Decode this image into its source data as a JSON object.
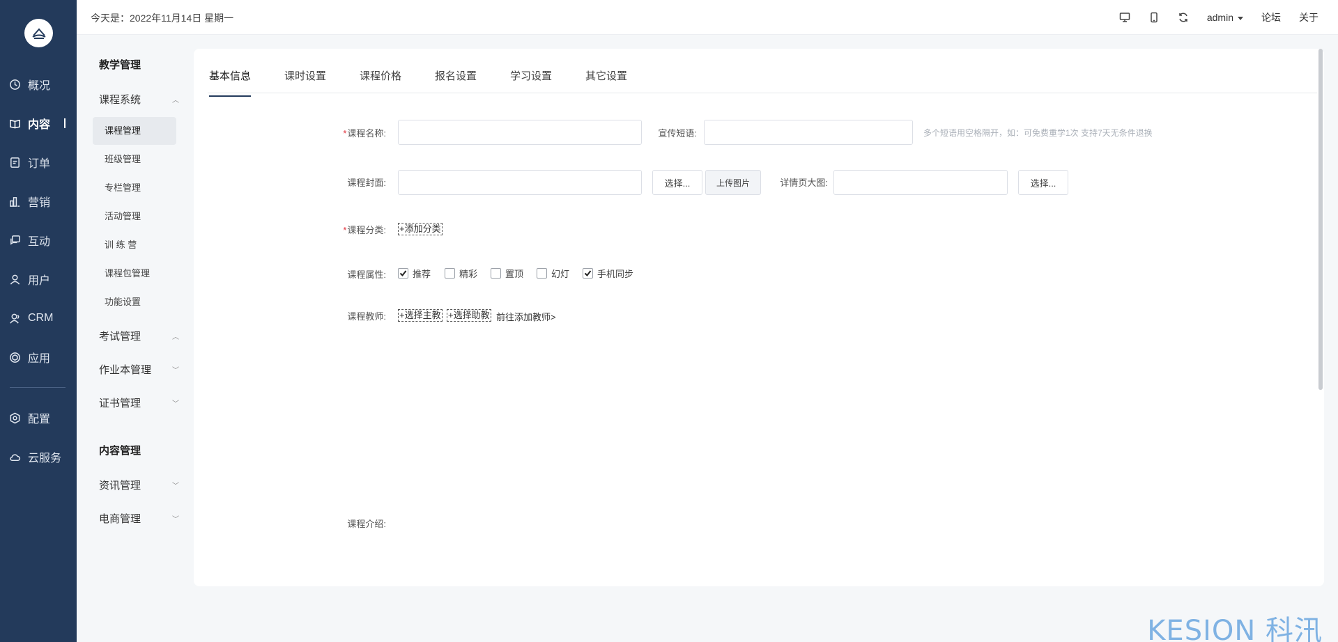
{
  "topbar": {
    "date_text": "今天是：2022年11月14日 星期一",
    "user": "admin",
    "forum": "论坛",
    "about": "关于"
  },
  "nav": {
    "items": [
      {
        "label": "概况",
        "icon": "clock-icon"
      },
      {
        "label": "内容",
        "icon": "book-icon"
      },
      {
        "label": "订单",
        "icon": "document-icon"
      },
      {
        "label": "营销",
        "icon": "bar-chart-icon"
      },
      {
        "label": "互动",
        "icon": "chat-icon"
      },
      {
        "label": "用户",
        "icon": "user-icon"
      },
      {
        "label": "CRM",
        "icon": "contacts-icon"
      },
      {
        "label": "应用",
        "icon": "cube-icon"
      },
      {
        "label": "配置",
        "icon": "gear-icon"
      },
      {
        "label": "云服务",
        "icon": "cloud-icon"
      }
    ]
  },
  "subnav": {
    "heading1": "教学管理",
    "group_course": "课程系统",
    "items": [
      "课程管理",
      "班级管理",
      "专栏管理",
      "活动管理",
      "训 练 营",
      "课程包管理",
      "功能设置"
    ],
    "group_exam": "考试管理",
    "group_homework": "作业本管理",
    "group_cert": "证书管理",
    "heading2": "内容管理",
    "group_news": "资讯管理",
    "group_ecom": "电商管理"
  },
  "tabs": [
    "基本信息",
    "课时设置",
    "课程价格",
    "报名设置",
    "学习设置",
    "其它设置"
  ],
  "form": {
    "course_name_label": "课程名称:",
    "slogan_label": "宣传短语:",
    "slogan_hint": "多个短语用空格隔开，如：可免费重学1次 支持7天无条件退换",
    "cover_label": "课程封面:",
    "select_btn": "选择...",
    "upload_btn": "上传图片",
    "detail_img_label": "详情页大图:",
    "category_label": "课程分类:",
    "add_category": "+添加分类",
    "attr_label": "课程属性:",
    "attrs": [
      {
        "label": "推荐",
        "checked": true
      },
      {
        "label": "精彩",
        "checked": false
      },
      {
        "label": "置顶",
        "checked": false
      },
      {
        "label": "幻灯",
        "checked": false
      },
      {
        "label": "手机同步",
        "checked": true
      }
    ],
    "teacher_label": "课程教师:",
    "select_main_teacher": "+选择主教",
    "select_assistant": "+选择助教",
    "go_add_teacher": "前往添加教师>",
    "intro_label": "课程介绍:"
  },
  "brand": "KESION 科汛"
}
